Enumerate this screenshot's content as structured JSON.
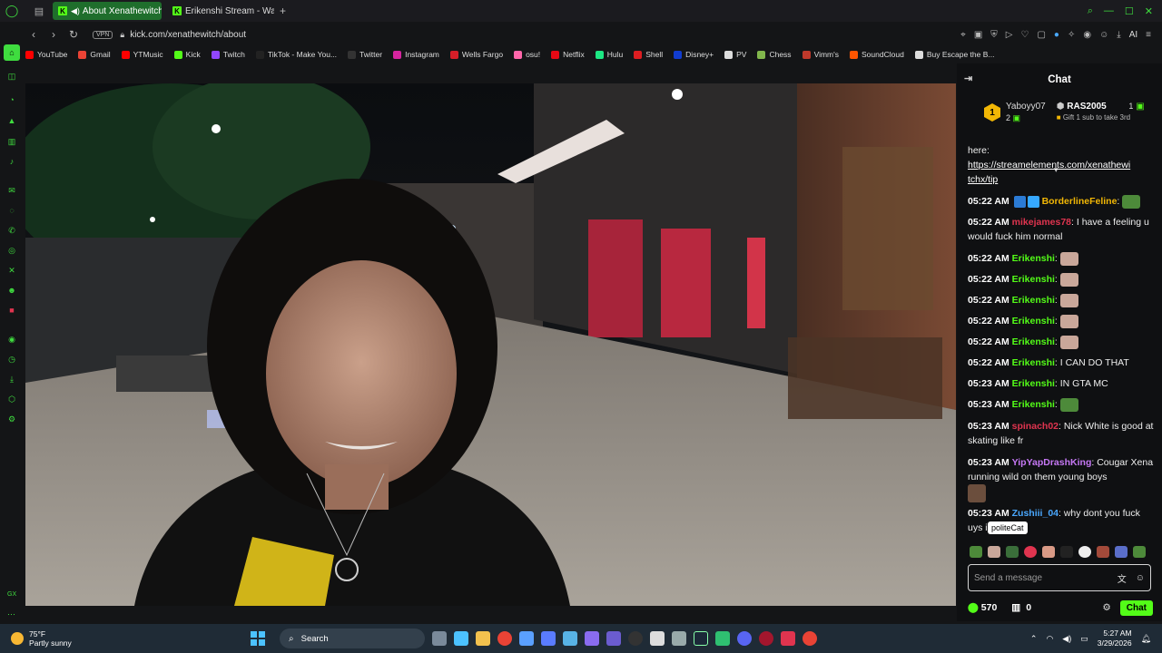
{
  "browser": {
    "tabs": [
      {
        "title": "About Xenathewitch -",
        "active": true
      },
      {
        "title": "Erikenshi Stream - Watch L",
        "active": false
      }
    ],
    "vpn_label": "VPN",
    "url": "kick.com/xenathewitch/about",
    "ai_label": "AI",
    "bookmarks": [
      {
        "label": "YouTube",
        "icon": "youtube-icon",
        "color": "#ff0000"
      },
      {
        "label": "Gmail",
        "icon": "gmail-icon",
        "color": "#ea4335"
      },
      {
        "label": "YTMusic",
        "icon": "ytmusic-icon",
        "color": "#ff0000"
      },
      {
        "label": "Kick",
        "icon": "kick-icon",
        "color": "#53fc18"
      },
      {
        "label": "Twitch",
        "icon": "twitch-icon",
        "color": "#9146ff"
      },
      {
        "label": "TikTok - Make You...",
        "icon": "tiktok-icon",
        "color": "#222222"
      },
      {
        "label": "Twitter",
        "icon": "x-icon",
        "color": "#333333"
      },
      {
        "label": "Instagram",
        "icon": "instagram-icon",
        "color": "#d6249f"
      },
      {
        "label": "Wells Fargo",
        "icon": "wellsfargo-icon",
        "color": "#d71e28"
      },
      {
        "label": "osu!",
        "icon": "osu-icon",
        "color": "#ff66aa"
      },
      {
        "label": "Netflix",
        "icon": "netflix-icon",
        "color": "#e50914"
      },
      {
        "label": "Hulu",
        "icon": "hulu-icon",
        "color": "#1ce783"
      },
      {
        "label": "Shell",
        "icon": "shell-icon",
        "color": "#dd1d21"
      },
      {
        "label": "Disney+",
        "icon": "disney-icon",
        "color": "#113ccf"
      },
      {
        "label": "PV",
        "icon": "pv-icon",
        "color": "#dddddd"
      },
      {
        "label": "Chess",
        "icon": "chess-icon",
        "color": "#81b64c"
      },
      {
        "label": "Vimm's",
        "icon": "vimms-icon",
        "color": "#c0392b"
      },
      {
        "label": "SoundCloud",
        "icon": "soundcloud-icon",
        "color": "#ff5500"
      },
      {
        "label": "Buy Escape the B...",
        "icon": "escape-icon",
        "color": "#dddddd"
      }
    ]
  },
  "sidebar": {
    "gx_label": "GX"
  },
  "chat": {
    "title": "Chat",
    "pinned": {
      "rank": "1",
      "left_user": "Yaboyy07",
      "left_count": "2",
      "right_user": "RAS2005",
      "right_count": "1",
      "right_sub": "Gift 1 sub to take 3rd"
    },
    "messages": {
      "m0": {
        "text": "here:"
      },
      "m1": {
        "link": "https://streamelements.com/xenathewi tchx/tip"
      },
      "m2": {
        "time": "05:22 AM",
        "user": "BorderlineFeline",
        "text": ":"
      },
      "m3": {
        "time": "05:22 AM",
        "user": "mikejames78",
        "text": ": I have a feeling u would fuck him normal"
      },
      "m4": {
        "time": "05:22 AM",
        "user": "Erikenshi",
        "text": ":"
      },
      "m5": {
        "time": "05:22 AM",
        "user": "Erikenshi",
        "text": ":"
      },
      "m6": {
        "time": "05:22 AM",
        "user": "Erikenshi",
        "text": ":"
      },
      "m7": {
        "time": "05:22 AM",
        "user": "Erikenshi",
        "text": ":"
      },
      "m8": {
        "time": "05:22 AM",
        "user": "Erikenshi",
        "text": ":"
      },
      "m9": {
        "time": "05:22 AM",
        "user": "Erikenshi",
        "text": ": I CAN DO THAT"
      },
      "m10": {
        "time": "05:23 AM",
        "user": "Erikenshi",
        "text": ": IN GTA MC"
      },
      "m11": {
        "time": "05:23 AM",
        "user": "Erikenshi",
        "text": ":"
      },
      "m12": {
        "time": "05:23 AM",
        "user": "spinach02",
        "text": ": Nick White is good at skating like fr"
      },
      "m13": {
        "time": "05:23 AM",
        "user": "YipYapDrashKing",
        "text": ": Cougar Xena running wild on them young boys"
      },
      "m14": {
        "time": "05:23 AM",
        "user": "Zushiii_04",
        "text": ": why dont you fuck",
        "text2": "uys in tinder"
      }
    },
    "user_colors": {
      "BorderlineFeline": "#f2b705",
      "mikejames78": "#e0344f",
      "Erikenshi": "#53fc18",
      "spinach02": "#e0344f",
      "YipYapDrashKing": "#c678f5",
      "Zushiii_04": "#4aa8ff"
    },
    "tooltip": "politeCat",
    "input_placeholder": "Send a message",
    "points": "570",
    "gifts": "0",
    "send_label": "Chat"
  },
  "taskbar": {
    "weather_temp": "75°F",
    "weather_desc": "Partly sunny",
    "search_label": "Search",
    "time": "5:27 AM",
    "date": "3/29/2026"
  },
  "colors": {
    "kick_green": "#53fc18",
    "opera_gx_green": "#3fdc3f",
    "active_tab": "#1f6e2c"
  }
}
